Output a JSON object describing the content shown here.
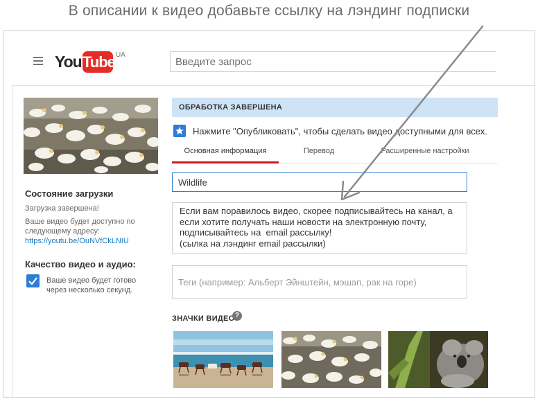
{
  "annotation": {
    "caption": "В описании к видео добавьте ссылку на лэндинг подписки"
  },
  "masthead": {
    "logo_you": "You",
    "logo_tube": "Tube",
    "logo_region": "UA",
    "search_placeholder": "Введите запрос"
  },
  "sidebar": {
    "upload_status_title": "Состояние загрузки",
    "upload_status_text": "Загрузка завершена!",
    "available_text": "Ваше видео будет доступно по следующему адресу:",
    "video_link": "https://youtu.be/OuNVfCkLNIU",
    "quality_title": "Качество видео и аудио:",
    "quality_text": "Ваше видео будет готово через несколько секунд."
  },
  "main": {
    "banner": "ОБРАБОТКА ЗАВЕРШЕНА",
    "publish_note": "Нажмите \"Опубликовать\", чтобы сделать видео доступными для всех.",
    "tabs": [
      {
        "label": "Основная информация",
        "active": true
      },
      {
        "label": "Перевод",
        "active": false
      },
      {
        "label": "Расширенные настройки",
        "active": false
      }
    ],
    "title_value": "Wildlife",
    "description_value": "Если вам поравилось видео, скорее подписывайтесь на канал, а если хотите получать наши новости на электронную почту, подписывайтесь на  email рассылку!\n(сылка на лэндинг email рассылки)",
    "tags_placeholder": "Теги (например: Альберт Эйнштейн, мэшап, рак на горе)",
    "thumbnails_title": "ЗНАЧКИ ВИДЕО",
    "help_glyph": "?"
  },
  "colors": {
    "brand_red": "#e52d27",
    "accent_blue": "#2d7dd2",
    "banner_bg": "#cfe3f7",
    "link": "#167ac6"
  }
}
